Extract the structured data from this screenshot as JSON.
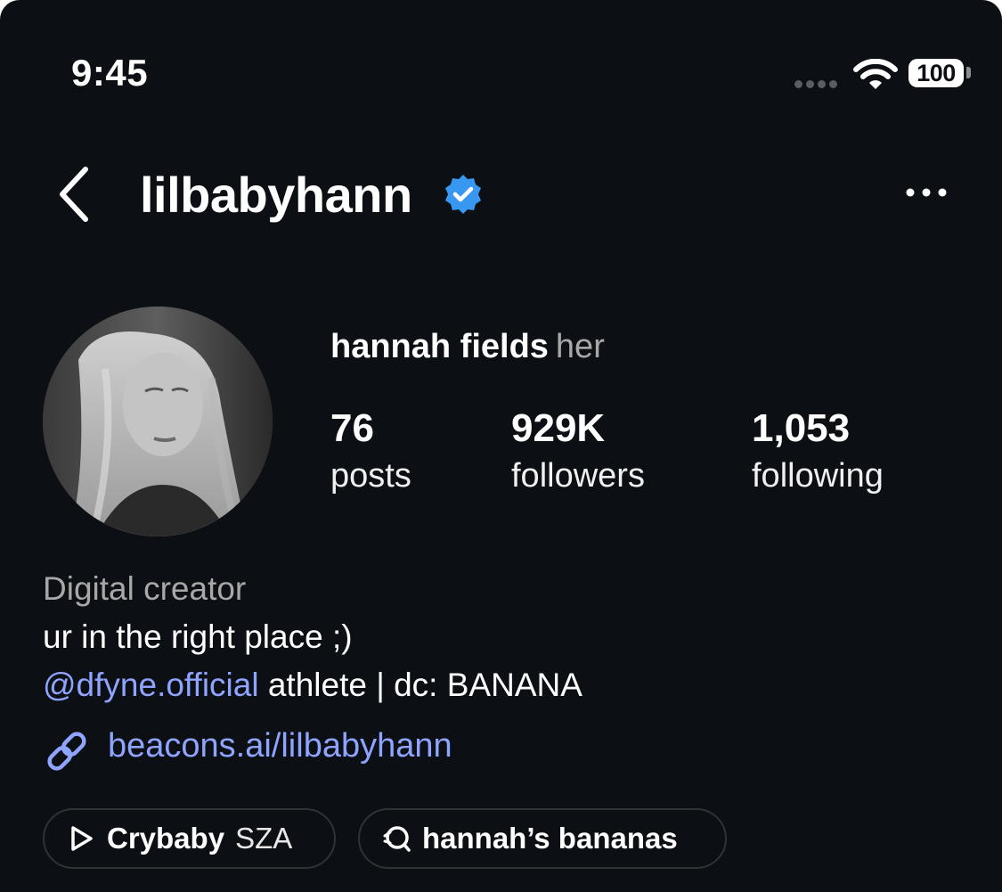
{
  "status_bar": {
    "time": "9:45",
    "battery": "100",
    "icons": [
      "signal-dots-icon",
      "wifi-icon",
      "battery-icon"
    ]
  },
  "header": {
    "username": "lilbabyhann",
    "back_icon": "chevron-left-icon",
    "verified_icon": "verified-badge-icon",
    "more_icon": "ellipsis-icon"
  },
  "profile": {
    "name": "hannah fields",
    "pronouns": "her",
    "stats": [
      {
        "value": "76",
        "label": "posts"
      },
      {
        "value": "929K",
        "label": "followers"
      },
      {
        "value": "1,053",
        "label": "following"
      }
    ]
  },
  "bio": {
    "category": "Digital creator",
    "line1": "ur in the right place ;)",
    "mention": "@dfyne.official",
    "line2_rest": " athlete | dc: BANANA",
    "link_icon": "link-icon",
    "link": "beacons.ai/lilbabyhann"
  },
  "chips": [
    {
      "icon": "play-icon",
      "title": "Crybaby",
      "subtitle": "SZA"
    },
    {
      "icon": "threads-icon",
      "title": "hannah’s bananas"
    }
  ],
  "colors": {
    "background": "#0c1014",
    "text": "#ffffff",
    "secondary_text": "#a8a8a8",
    "link": "#8ea4ff",
    "verified": "#3897f0",
    "chip_border": "#2f3336"
  }
}
